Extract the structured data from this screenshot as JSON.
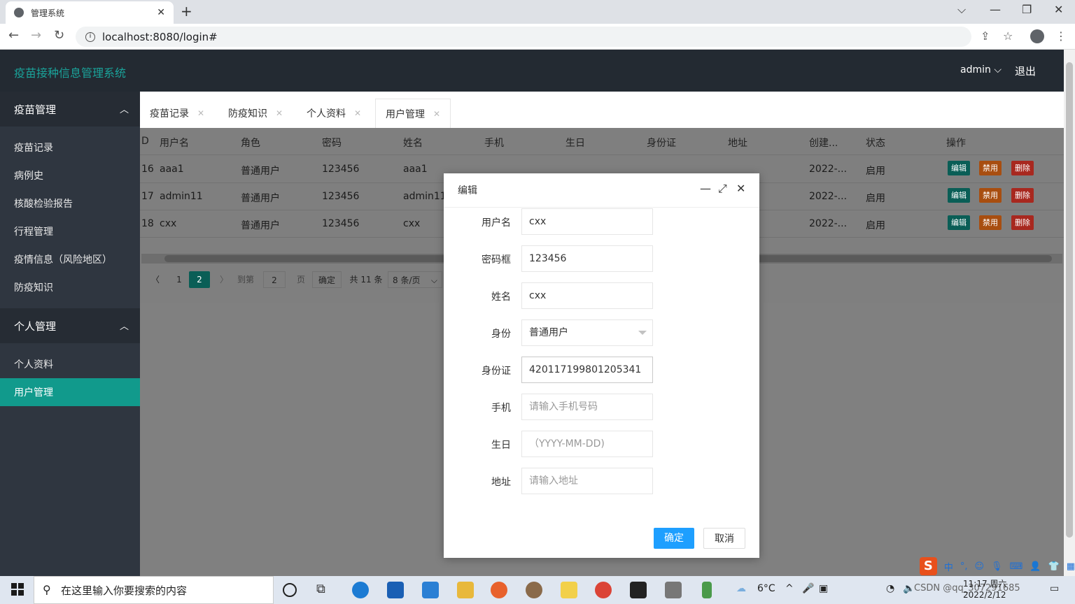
{
  "browser": {
    "tab_title": "管理系统",
    "tab_close": "✕",
    "new_tab": "+",
    "url": "localhost:8080/login#"
  },
  "app": {
    "title": "疫苗接种信息管理系统",
    "user": "admin ⌵",
    "logout": "退出"
  },
  "sidebar": {
    "groups": [
      {
        "label": "疫苗管理",
        "items": [
          "疫苗记录",
          "病例史",
          "核酸检验报告",
          "行程管理",
          "疫情信息（风险地区）",
          "防疫知识"
        ]
      },
      {
        "label": "个人管理",
        "items": [
          "个人资料",
          "用户管理"
        ]
      }
    ],
    "active": "用户管理"
  },
  "tabs": [
    "疫苗记录",
    "防疫知识",
    "个人资料",
    "用户管理"
  ],
  "table": {
    "headers": [
      "D",
      "用户名",
      "角色",
      "密码",
      "姓名",
      "手机",
      "生日",
      "身份证",
      "地址",
      "创建...",
      "状态",
      "操作"
    ],
    "rows": [
      {
        "id": "16",
        "username": "aaa1",
        "role": "普通用户",
        "password": "123456",
        "name": "aaa1",
        "created": "2022-...",
        "status": "启用"
      },
      {
        "id": "17",
        "username": "admin11",
        "role": "普通用户",
        "password": "123456",
        "name": "admin11",
        "created": "2022-...",
        "status": "启用"
      },
      {
        "id": "18",
        "username": "cxx",
        "role": "普通用户",
        "password": "123456",
        "name": "cxx",
        "created": "2022-...",
        "status": "启用"
      }
    ],
    "actions": {
      "edit": "编辑",
      "disable": "禁用",
      "delete": "删除"
    }
  },
  "pager": {
    "prev": "〈",
    "page1": "1",
    "page2": "2",
    "next": "〉",
    "goto_label": "到第",
    "goto_value": "2",
    "page_label": "页",
    "confirm": "确定",
    "total": "共 11 条",
    "per_page": "8 条/页"
  },
  "dialog": {
    "title": "编辑",
    "fields": [
      {
        "label": "用户名",
        "value": "cxx",
        "placeholder": ""
      },
      {
        "label": "密码框",
        "value": "123456",
        "placeholder": ""
      },
      {
        "label": "姓名",
        "value": "cxx",
        "placeholder": ""
      },
      {
        "label": "身份",
        "value": "普通用户",
        "placeholder": ""
      },
      {
        "label": "身份证",
        "value": "420117199801205341",
        "placeholder": ""
      },
      {
        "label": "手机",
        "value": "",
        "placeholder": "请输入手机号码"
      },
      {
        "label": "生日",
        "value": "",
        "placeholder": "（YYYY-MM-DD)"
      },
      {
        "label": "地址",
        "value": "",
        "placeholder": "请输入地址"
      }
    ],
    "ok": "确定",
    "cancel": "取消"
  },
  "taskbar": {
    "search_placeholder": "在这里输入你要搜索的内容",
    "weather": "6°C",
    "time": "11:17 周六",
    "date": "2022/2/12",
    "watermark": "CSDN @qq_307291685"
  },
  "ime": {
    "logo": "S",
    "mode": "中"
  }
}
